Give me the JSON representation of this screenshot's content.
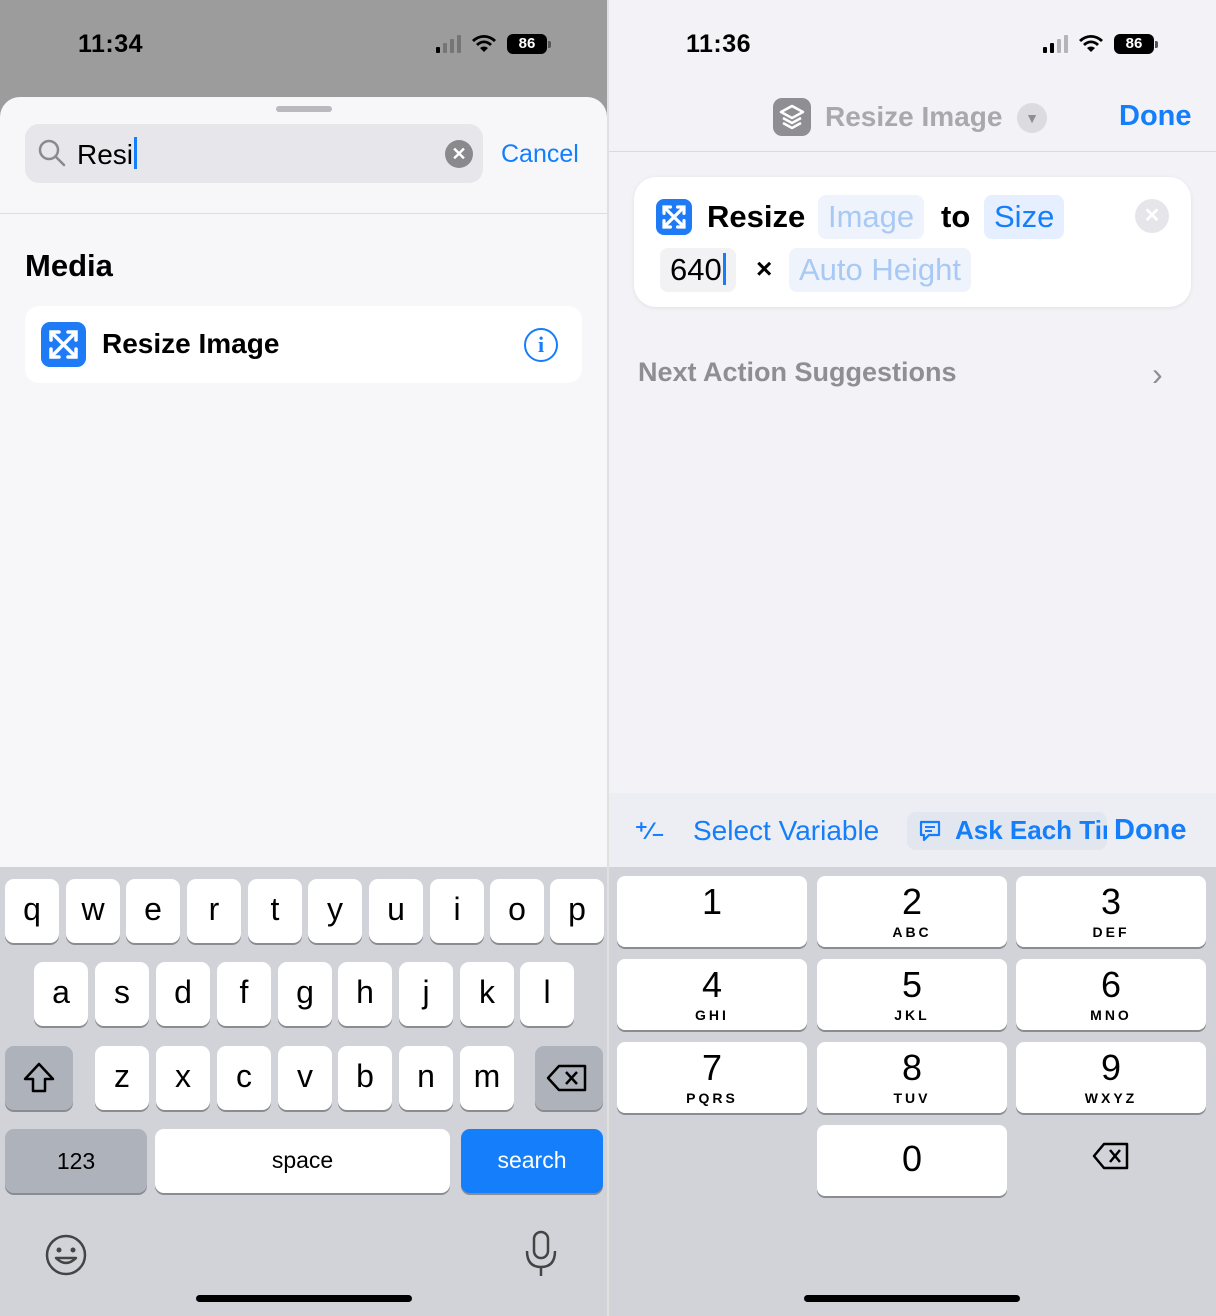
{
  "left": {
    "status": {
      "time": "11:34",
      "battery": "86"
    },
    "search": {
      "query": "Resi",
      "cancel_label": "Cancel"
    },
    "section_title": "Media",
    "results": [
      {
        "label": "Resize Image"
      }
    ],
    "keyboard": {
      "row1": [
        "q",
        "w",
        "e",
        "r",
        "t",
        "y",
        "u",
        "i",
        "o",
        "p"
      ],
      "row2": [
        "a",
        "s",
        "d",
        "f",
        "g",
        "h",
        "j",
        "k",
        "l"
      ],
      "row3": [
        "z",
        "x",
        "c",
        "v",
        "b",
        "n",
        "m"
      ],
      "numbers_label": "123",
      "space_label": "space",
      "search_label": "search"
    }
  },
  "right": {
    "status": {
      "time": "11:36",
      "battery": "86"
    },
    "nav": {
      "title": "Resize Image",
      "done_label": "Done"
    },
    "action": {
      "verb": "Resize",
      "input_token": "Image",
      "connector": "to",
      "mode_token": "Size",
      "width_value": "640",
      "times_symbol": "×",
      "height_token": "Auto Height"
    },
    "suggestions_label": "Next Action Suggestions",
    "variable_bar": {
      "magic_symbol": "⁺∕₋",
      "select_variable_label": "Select Variable",
      "ask_each_time_label": "Ask Each Time",
      "done_label": "Done"
    },
    "keypad": [
      {
        "digit": "1",
        "letters": ""
      },
      {
        "digit": "2",
        "letters": "ABC"
      },
      {
        "digit": "3",
        "letters": "DEF"
      },
      {
        "digit": "4",
        "letters": "GHI"
      },
      {
        "digit": "5",
        "letters": "JKL"
      },
      {
        "digit": "6",
        "letters": "MNO"
      },
      {
        "digit": "7",
        "letters": "PQRS"
      },
      {
        "digit": "8",
        "letters": "TUV"
      },
      {
        "digit": "9",
        "letters": "WXYZ"
      },
      {
        "digit": "0",
        "letters": ""
      }
    ]
  },
  "colors": {
    "accent": "#147efb",
    "action_icon": "#1f7af6",
    "keyboard_bg": "#d1d3d9"
  }
}
